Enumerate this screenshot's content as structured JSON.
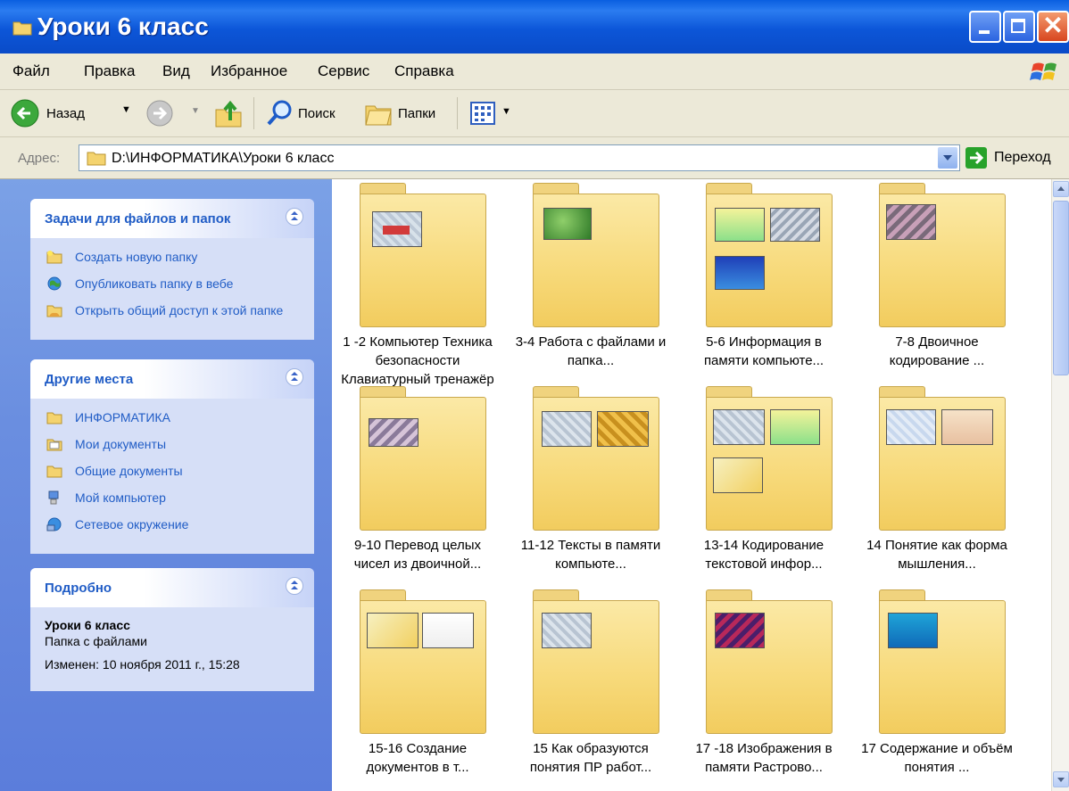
{
  "window": {
    "title": "Уроки 6 класс"
  },
  "menu": [
    "Файл",
    "Правка",
    "Вид",
    "Избранное",
    "Сервис",
    "Справка"
  ],
  "toolbar": {
    "back": "Назад",
    "search": "Поиск",
    "folders": "Папки"
  },
  "address": {
    "label": "Адрес:",
    "path": "D:\\ИНФОРМАТИКА\\Уроки 6 класс",
    "go": "Переход"
  },
  "tasks_panel": {
    "title": "Задачи для файлов и папок",
    "items": [
      "Создать новую папку",
      "Опубликовать папку в вебе",
      "Открыть общий доступ к этой папке"
    ]
  },
  "places_panel": {
    "title": "Другие места",
    "items": [
      "ИНФОРМАТИКА",
      "Мои документы",
      "Общие документы",
      "Мой компьютер",
      "Сетевое окружение"
    ]
  },
  "details_panel": {
    "title": "Подробно",
    "name": "Уроки 6 класс",
    "type": "Папка с файлами",
    "modified": "Изменен: 10 ноября 2011 г., 15:28"
  },
  "folders": [
    "1 -2 Компьютер Техника безопасности Клавиатурный тренажёр",
    "3-4  Работа с файлами и папка...",
    "5-6 Информация в памяти компьюте...",
    "7-8 Двоичное кодирование ...",
    "9-10 Перевод  целых чисел из двоичной...",
    "11-12 Тексты  в памяти компьюте...",
    "13-14 Кодирование текстовой инфор...",
    "14 Понятие как форма мышления...",
    "15-16  Создание документов в т...",
    "15 Как образуются понятия ПР работ...",
    "17 -18  Изображения в памяти Растрово...",
    "17 Содержание и объём понятия ..."
  ],
  "colors": {
    "title_bar": "#0a5fe0",
    "task_pane": "#6a8ee0",
    "link": "#215dc6",
    "folder": "#f7d979"
  }
}
